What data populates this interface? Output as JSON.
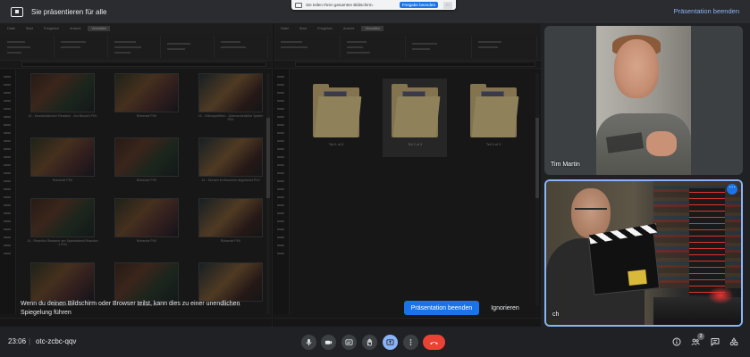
{
  "top_banner": {
    "title": "Sie präsentieren für alle",
    "stop_link": "Präsentation beenden"
  },
  "share_notice": {
    "text": "Sie teilen Ihren gesamten Bildschirm.",
    "stop_button": "Freigabe beenden",
    "hide_button": "..."
  },
  "shared_screen": {
    "left_explorer": {
      "tabs": [
        "Datei",
        "Start",
        "Freigeben",
        "Ansicht",
        "Verwalten"
      ],
      "thumbnails": [
        "14 - Kunststückchen Reaction - Am Besuch PIXI",
        "Ruhende PIXI",
        "14 - Videospiel/Iten - Unterschiedliche Spieler PIXI",
        "Ruhende PIXI",
        "Ruhende PIXI",
        "14 - Szenen im Brummer abgedeckt PIXI",
        "14 - Reaction Streamer am Spieleabend Reaction 1 PIXI",
        "Ruhende PIXI",
        "Ruhende PIXI",
        "Ruhende PIXI",
        "Ruhende PIXI",
        "Ruhende PIXI"
      ]
    },
    "right_explorer": {
      "tabs": [
        "Datei",
        "Start",
        "Freigeben",
        "Ansicht",
        "Verwalten"
      ],
      "folders": [
        "Teil 1 of 3",
        "Teil 2 of 3",
        "Teil 3 of 3"
      ]
    }
  },
  "warning": {
    "text": "Wenn du deinen Bildschirm oder Browser teilst, kann dies zu einer unendlichen Spiegelung führen",
    "stop_button": "Präsentation beenden",
    "ignore_button": "Ignorieren"
  },
  "participants": [
    {
      "name": "Tim Martin"
    },
    {
      "name": "ch"
    }
  ],
  "bottom_bar": {
    "time": "23:06",
    "separator": "|",
    "meeting_code": "otc-zcbc-qqv",
    "participant_count": "3"
  },
  "colors": {
    "accent": "#8ab4f8",
    "primary_button": "#1a73e8",
    "hangup": "#ea4335",
    "background": "#202124",
    "control": "#3c4043"
  },
  "icons": [
    "present-icon",
    "mic-icon",
    "camera-icon",
    "captions-icon",
    "raise-hand-icon",
    "present-now-icon",
    "more-options-icon",
    "hangup-icon",
    "info-icon",
    "people-icon",
    "chat-icon",
    "activities-icon"
  ]
}
